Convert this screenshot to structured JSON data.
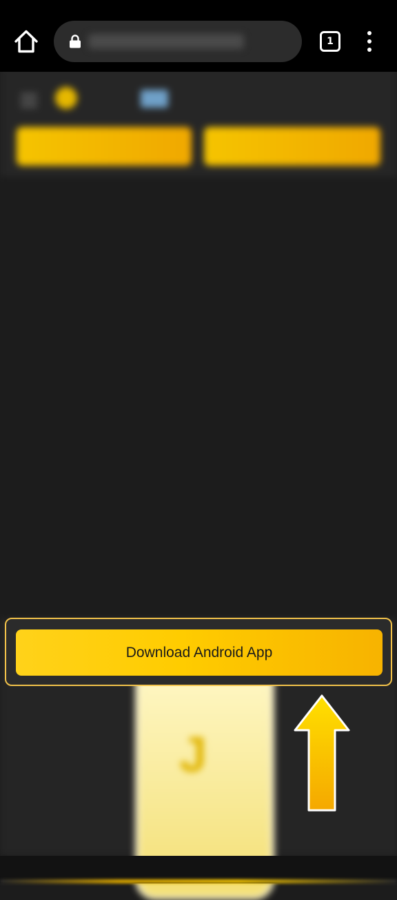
{
  "browser": {
    "url": "",
    "tab_count": "1"
  },
  "page": {
    "header": {
      "logo_text": "",
      "register_label": "",
      "install_label": ""
    },
    "breadcrumb": "",
    "heading": "",
    "paragraph": "",
    "badge_text": ""
  },
  "cta": {
    "download_label": "Download Android App"
  },
  "colors": {
    "accent_yellow": "#ffcc00",
    "accent_orange": "#f7b300",
    "highlight_border": "#f2c24a",
    "background": "#1c1c1c",
    "chrome": "#000000"
  },
  "icons": [
    "home-icon",
    "lock-icon",
    "tab-switcher-icon",
    "more-vert-icon",
    "arrow-up-icon"
  ]
}
